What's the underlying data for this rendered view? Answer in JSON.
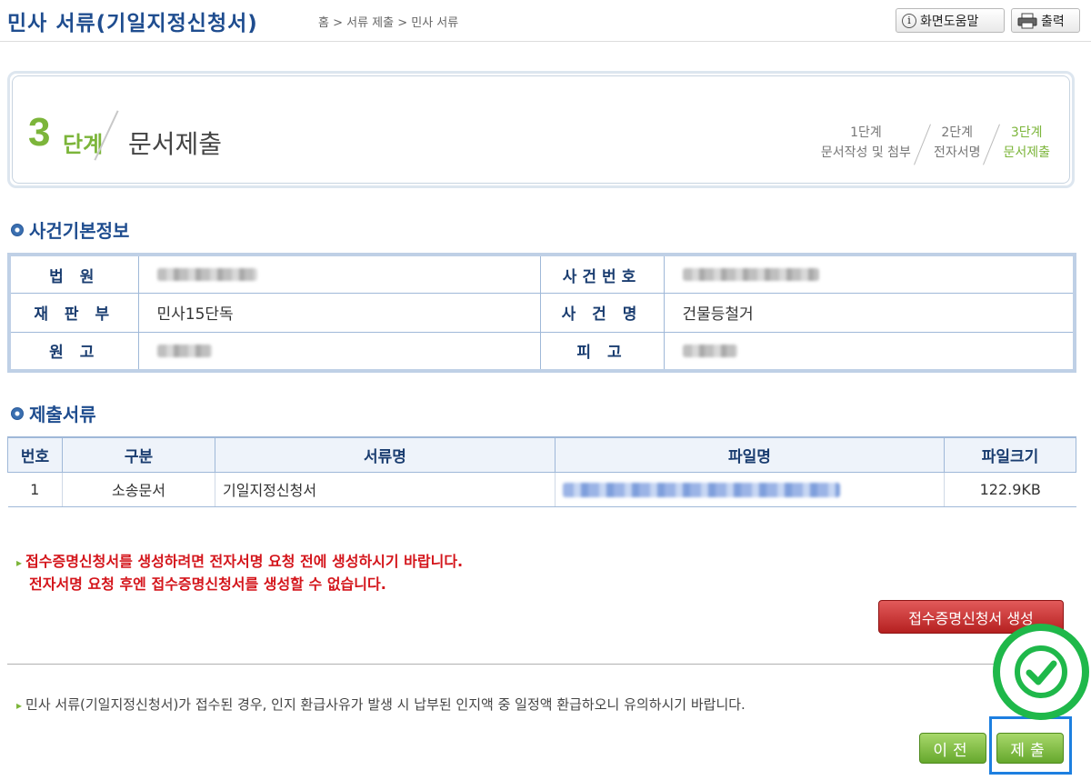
{
  "header": {
    "title": "민사 서류(기일지정신청서)",
    "breadcrumb": "홈 > 서류 제출 > 민사 서류",
    "help_label": "화면도움말",
    "print_label": "출력"
  },
  "step_box": {
    "current_number": "3",
    "current_word": "단계",
    "current_name": "문서제출",
    "steps": [
      {
        "label": "1단계",
        "desc": "문서작성 및 첨부"
      },
      {
        "label": "2단계",
        "desc": "전자서명"
      },
      {
        "label": "3단계",
        "desc": "문서제출"
      }
    ]
  },
  "case_info": {
    "title": "사건기본정보",
    "court_label": "법 원",
    "case_number_label": "사건번호",
    "division_label": "재 판 부",
    "division_value": "민사15단독",
    "case_name_label": "사 건 명",
    "case_name_value": "건물등철거",
    "plaintiff_label": "원 고",
    "defendant_label": "피 고"
  },
  "documents": {
    "title": "제출서류",
    "columns": [
      "번호",
      "구분",
      "서류명",
      "파일명",
      "파일크기"
    ],
    "rows": [
      {
        "no": "1",
        "category": "소송문서",
        "doc_name": "기일지정신청서",
        "file_size": "122.9KB"
      }
    ]
  },
  "notice_red": {
    "line1": "접수증명신청서를 생성하려면 전자서명 요청 전에 생성하시기 바랍니다.",
    "line2": "전자서명 요청 후엔 접수증명신청서를 생성할 수 없습니다."
  },
  "receipt_button_label": "접수증명신청서 생성",
  "notice_gray": "민사 서류(기일지정신청서)가 접수된 경우, 인지 환급사유가 발생 시 납부된 인지액 중 일정액 환급하오니 유의하시기 바랍니다.",
  "buttons": {
    "prev_label": "이전",
    "submit_label": "제출"
  },
  "colors": {
    "title_blue": "#1f4d8f",
    "step_green": "#7cb53a",
    "notice_red": "#d4151b",
    "highlight_blue": "#1d7fe0",
    "check_green": "#1fb84a"
  }
}
